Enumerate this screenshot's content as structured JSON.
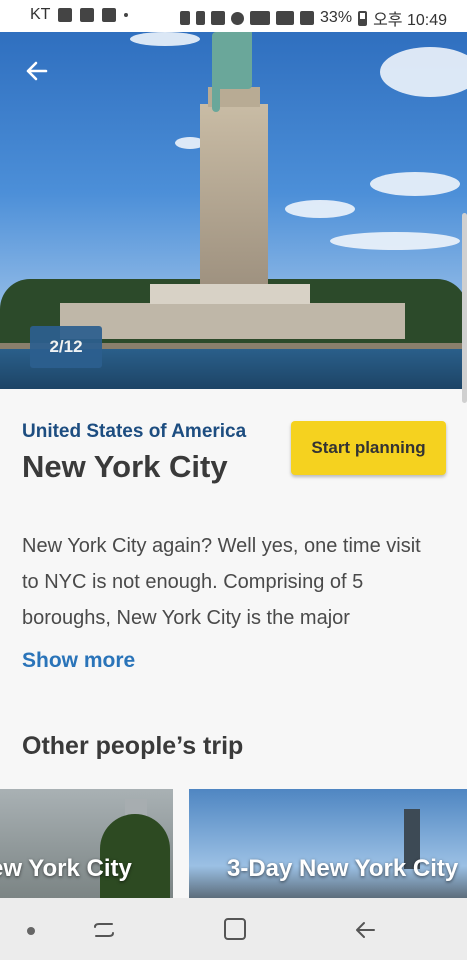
{
  "status_bar": {
    "carrier": "KT",
    "battery": "33%",
    "time": "오후 10:49"
  },
  "hero": {
    "counter": "2/12",
    "back_icon": "arrow-left-icon"
  },
  "destination": {
    "country": "United States of America",
    "city": "New York City",
    "start_button": "Start planning",
    "description": "New York City again? Well yes, one time visit to NYC is not enough. Comprising of 5 boroughs, New York City is the major",
    "show_more": "Show more"
  },
  "others": {
    "title": "Other people’s trip",
    "cards": [
      {
        "label": "ew York City"
      },
      {
        "label": "3-Day New York City"
      }
    ]
  },
  "colors": {
    "accent_yellow": "#f5d21f",
    "brand_blue": "#1d4d80",
    "link_blue": "#2a74b9"
  }
}
